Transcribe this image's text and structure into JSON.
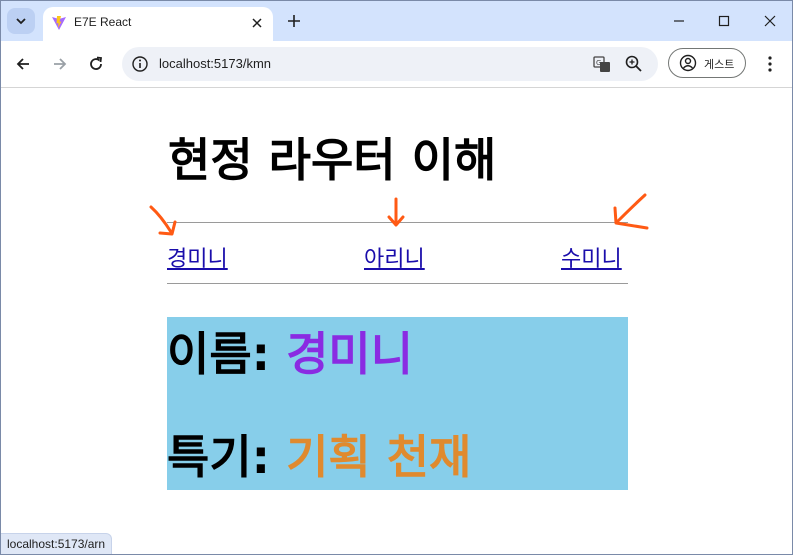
{
  "browser": {
    "tab_title": "E7E React",
    "url": "localhost:5173/kmn",
    "profile_label": "게스트",
    "status_url": "localhost:5173/arn"
  },
  "page": {
    "title": "현정 라우터 이해",
    "nav": [
      {
        "label": "경미니"
      },
      {
        "label": "아리니"
      },
      {
        "label": "수미니"
      }
    ],
    "profile": {
      "name_label": "이름:",
      "name_value": "경미니",
      "talent_label": "특기:",
      "talent_value": "기획 천재"
    }
  },
  "colors": {
    "tabstrip": "#d3e3fd",
    "link": "#1a0dab",
    "profile_bg": "#87ceea",
    "name_value": "#8a2be2",
    "talent_value": "#e08a2e",
    "annotation_arrow": "#ff5a14"
  }
}
